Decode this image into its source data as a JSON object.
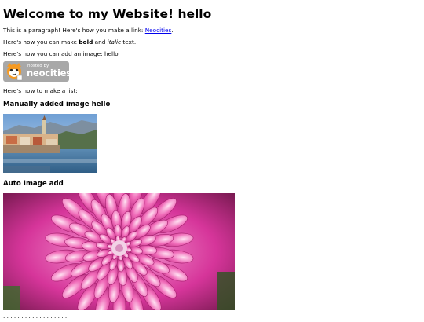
{
  "heading": "Welcome to my Website! hello",
  "paragraph": {
    "text_before_link": "This is a paragraph! Here's how you make a link: ",
    "link_text": "Neocities",
    "text_after_link": "."
  },
  "bold_line": {
    "before": "Here's how you can make ",
    "bold": "bold",
    "middle": " and ",
    "italic": "italic",
    "after": " text."
  },
  "image_line": "Here's how you can add an image: hello",
  "badge": {
    "hosted_by": "hosted by",
    "brand": "neocities"
  },
  "list_line": "Here's how to make a list:",
  "manual_image_heading": "Manually added image hello",
  "auto_image_heading": "Auto Image add",
  "colors": {
    "link": "#0000ee",
    "badge_bg": "#a8a8a8"
  }
}
